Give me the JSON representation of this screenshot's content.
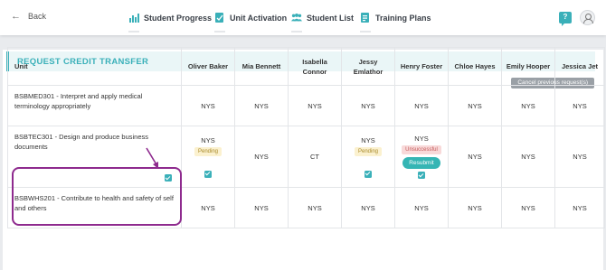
{
  "topbar": {
    "back_label": "Back",
    "nav": [
      {
        "label": "Student Progress",
        "icon": "bar-chart-icon"
      },
      {
        "label": "Unit Activation",
        "icon": "document-check-icon"
      },
      {
        "label": "Student List",
        "icon": "users-icon"
      },
      {
        "label": "Training Plans",
        "icon": "clipboard-icon"
      }
    ],
    "help_glyph": "?"
  },
  "panel": {
    "title": "REQUEST CREDIT TRANSFER",
    "cancel_label": "Cancel previous request(s)"
  },
  "table": {
    "unit_header": "Unit",
    "students": [
      "Oliver Baker",
      "Mia Bennett",
      "Isabella Connor",
      "Jessy Emlathor",
      "Henry Foster",
      "Chloe Hayes",
      "Emily Hooper",
      "Jessica Jet"
    ],
    "rows": [
      {
        "unit": "BSBMED301 - Interpret and apply medical terminology appropriately",
        "cells": [
          "NYS",
          "NYS",
          "NYS",
          "NYS",
          "NYS",
          "NYS",
          "NYS",
          "NYS"
        ]
      },
      {
        "unit": "BSBTEC301 - Design and produce business documents",
        "cells": [
          {
            "status": "NYS",
            "badge": "Pending",
            "checked": true
          },
          {
            "status": "NYS"
          },
          {
            "status": "CT"
          },
          {
            "status": "NYS",
            "badge": "Pending",
            "checked": true
          },
          {
            "status": "NYS",
            "badge": "Unsuccessful",
            "button": "Resubmit",
            "checked": true
          },
          {
            "status": "NYS"
          },
          {
            "status": "NYS"
          },
          {
            "status": "NYS"
          }
        ],
        "unit_checked": true
      },
      {
        "unit": "BSBWHS201 - Contribute to health and safety of self and others",
        "cells": [
          "NYS",
          "NYS",
          "NYS",
          "NYS",
          "NYS",
          "NYS",
          "NYS",
          "NYS"
        ]
      }
    ]
  },
  "colors": {
    "accent": "#3ab0b9",
    "annotation": "#8e2a8e",
    "pending_bg": "#fbf1cf",
    "unsuccessful_bg": "#f8d9d9"
  }
}
